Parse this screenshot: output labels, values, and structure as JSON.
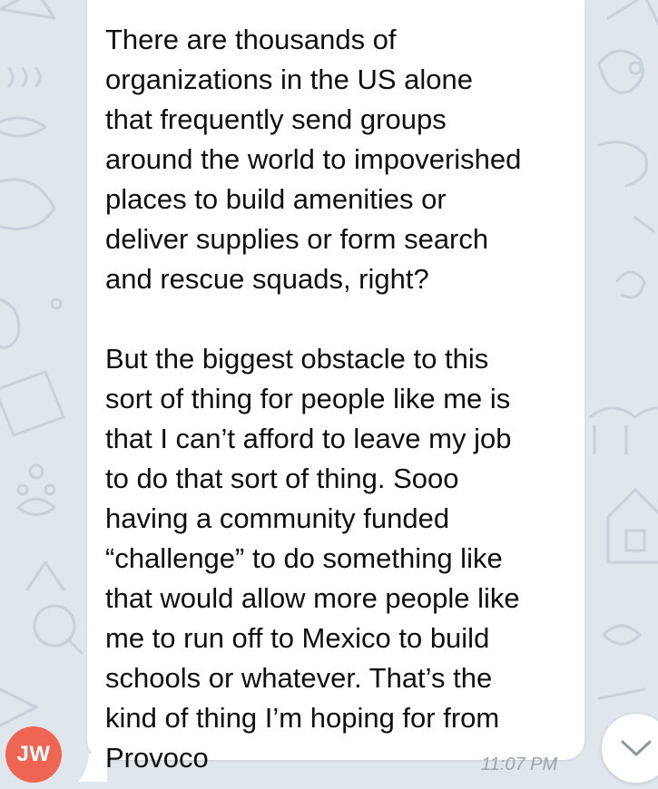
{
  "message": {
    "text": "There are thousands of\norganizations in the US alone\nthat frequently send groups\naround the world to impoverished\nplaces to build amenities or\ndeliver supplies or form search\nand rescue squads, right?\n\nBut the biggest obstacle to this\nsort of thing for people like me is\nthat I can’t afford to leave my job\nto do that sort of thing. Sooo\nhaving a community funded\n“challenge” to do something like\nthat would allow more people like\nme to run off to Mexico to build\nschools or whatever. That’s the\nkind of thing I’m hoping for from\nProvoco",
    "time": "11:07 PM"
  },
  "sender": {
    "initials": "JW",
    "avatar_color": "#ef6554"
  },
  "scroll_button": {
    "icon": "chevron-down-icon"
  },
  "colors": {
    "background": "#dfe6ec",
    "bubble": "#ffffff",
    "text": "#0f0f0f",
    "timestamp": "#9aa3ac"
  }
}
